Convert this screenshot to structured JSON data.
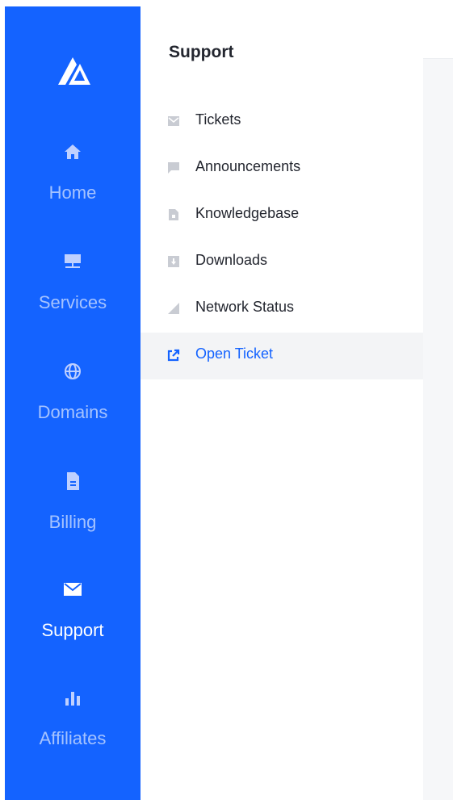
{
  "colors": {
    "rail_bg": "#1463ff",
    "accent": "#1463ff",
    "rail_icon": "#bfd0ff",
    "sub_icon": "#c9ccd3",
    "text": "#23262f"
  },
  "rail": {
    "logo_icon": "brand-logo",
    "items": [
      {
        "label": "Home",
        "icon": "home-icon",
        "active": false
      },
      {
        "label": "Services",
        "icon": "server-icon",
        "active": false
      },
      {
        "label": "Domains",
        "icon": "globe-icon",
        "active": false
      },
      {
        "label": "Billing",
        "icon": "document-icon",
        "active": false
      },
      {
        "label": "Support",
        "icon": "envelope-icon",
        "active": true
      },
      {
        "label": "Affiliates",
        "icon": "bar-chart-icon",
        "active": false
      }
    ]
  },
  "submenu": {
    "title": "Support",
    "items": [
      {
        "label": "Tickets",
        "icon": "inbox-icon",
        "active": false
      },
      {
        "label": "Announcements",
        "icon": "comment-icon",
        "active": false
      },
      {
        "label": "Knowledgebase",
        "icon": "file-icon",
        "active": false
      },
      {
        "label": "Downloads",
        "icon": "download-icon",
        "active": false
      },
      {
        "label": "Network Status",
        "icon": "signal-icon",
        "active": false
      },
      {
        "label": "Open Ticket",
        "icon": "external-link-icon",
        "active": true
      }
    ]
  }
}
